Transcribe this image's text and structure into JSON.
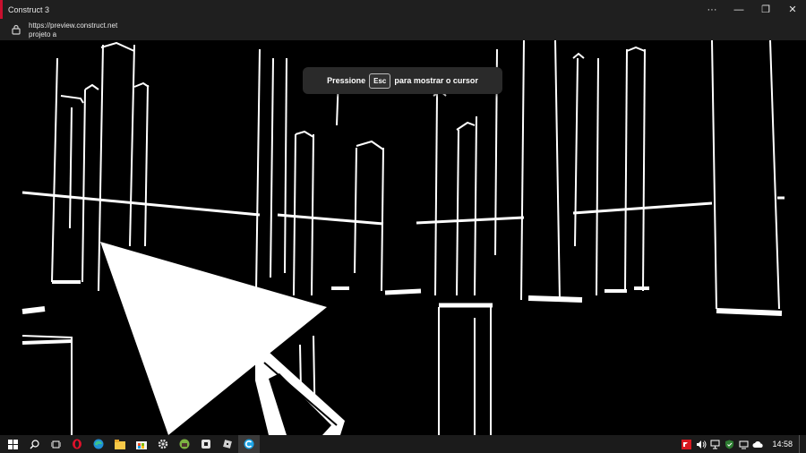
{
  "window": {
    "title": "Construct 3",
    "url": "https://preview.construct.net",
    "page_name": "projeto a",
    "controls": {
      "more": "···",
      "minimize": "—",
      "restore": "❐",
      "close": "✕"
    }
  },
  "toast": {
    "before": "Pressione",
    "key": "Esc",
    "after": "para mostrar o cursor"
  },
  "taskbar": {
    "time": "14:58",
    "apps": [
      "windows-start",
      "search",
      "task-view",
      "opera",
      "edge",
      "file-explorer",
      "microsoft-store",
      "settings",
      "minecraft",
      "roblox-studio",
      "roblox",
      "construct-3"
    ],
    "tray": [
      "amd",
      "volume",
      "display",
      "security",
      "network",
      "onedrive"
    ]
  },
  "colors": {
    "titlebar": "#1f1f1f",
    "taskbar": "#1b1b1b",
    "accent_red": "#c8102e",
    "scene_fg": "#ffffff",
    "scene_bg": "#000000"
  }
}
